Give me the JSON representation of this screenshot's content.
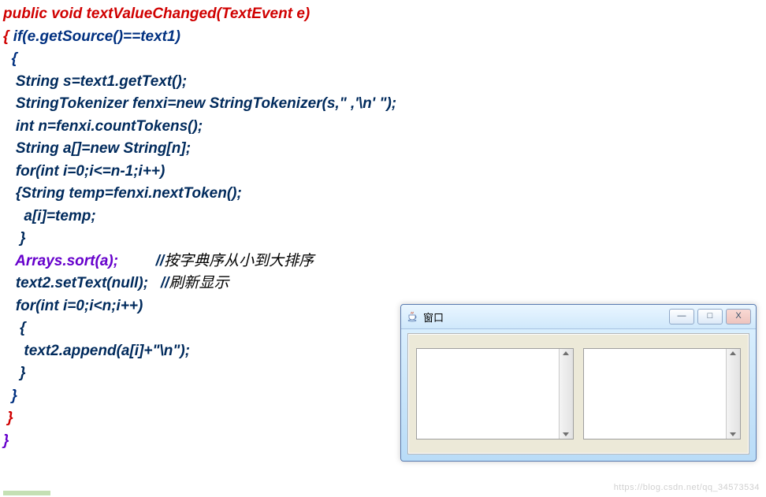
{
  "code": {
    "line1": "public void textValueChanged(TextEvent e)",
    "line2a": "{ ",
    "line2b": "if(e.getSource()==text1)",
    "line3": "  {",
    "line4": "   String s=text1.getText();",
    "line5": "   StringTokenizer fenxi=new StringTokenizer(s,\" ,'\\n' \");",
    "line6": "   int n=fenxi.countTokens();",
    "line7": "   String a[]=new String[n];",
    "line8": "   for(int i=0;i<=n-1;i++)",
    "line9": "   {String temp=fenxi.nextToken();",
    "line10": "     a[i]=temp;",
    "line11": "    }",
    "line12a": "   Arrays.sort(a);",
    "line12b": "         //",
    "line12c": "按字典序从小到大排序",
    "line13a": "   text2.setText(null);",
    "line13b": "   //",
    "line13c": "刷新显示",
    "line14": "   for(int i=0;i<n;i++)",
    "line15": "    {",
    "line16": "     text2.append(a[i]+\"\\n\");",
    "line17": "    }",
    "line18": "  }",
    "line19": " }",
    "line20": "}"
  },
  "window": {
    "title": "窗口",
    "minimize": "—",
    "maximize": "□",
    "close": "X"
  },
  "watermark": "https://blog.csdn.net/qq_34573534"
}
